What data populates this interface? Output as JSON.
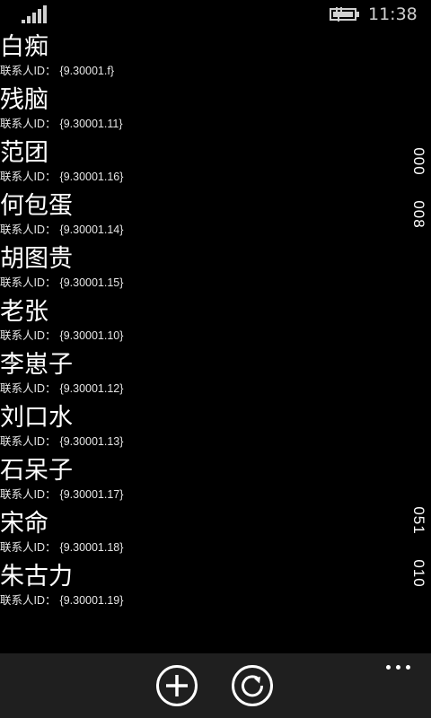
{
  "status_bar": {
    "time": "11:38",
    "signal_icon": "signal-strength-icon",
    "battery_icon": "battery-charging-icon"
  },
  "contact_id_label": "联系人ID：",
  "contacts": [
    {
      "name": "白痴",
      "id": "{9.30001.f}"
    },
    {
      "name": "残脑",
      "id": "{9.30001.11}"
    },
    {
      "name": "范团",
      "id": "{9.30001.16}"
    },
    {
      "name": "何包蛋",
      "id": "{9.30001.14}"
    },
    {
      "name": "胡图贵",
      "id": "{9.30001.15}"
    },
    {
      "name": "老张",
      "id": "{9.30001.10}"
    },
    {
      "name": "李崽子",
      "id": "{9.30001.12}"
    },
    {
      "name": "刘口水",
      "id": "{9.30001.13}"
    },
    {
      "name": "石呆子",
      "id": "{9.30001.17}"
    },
    {
      "name": "宋命",
      "id": "{9.30001.18}"
    },
    {
      "name": "朱古力",
      "id": "{9.30001.19}"
    }
  ],
  "side_numbers": [
    "000",
    "008",
    "051",
    "010"
  ],
  "app_bar": {
    "add_icon": "add-icon",
    "refresh_icon": "refresh-icon",
    "more_icon": "more-options-icon"
  },
  "colors": {
    "background": "#000000",
    "app_bar": "#1f1f1f",
    "text": "#ffffff"
  }
}
